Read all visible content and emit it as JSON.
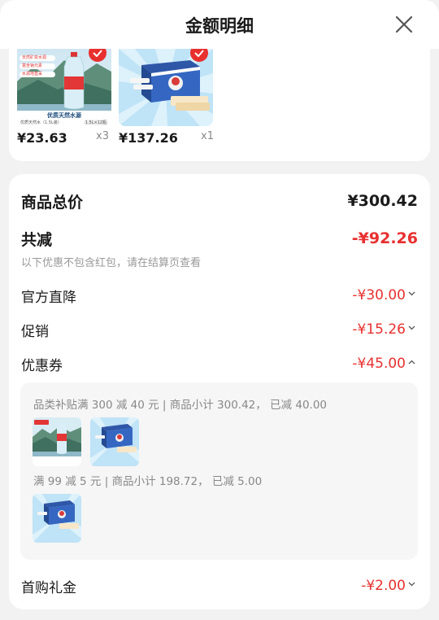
{
  "header": {
    "title": "金额明细"
  },
  "products": [
    {
      "label_lines": [
        "天然矿泉水源",
        "富含钠元素",
        "水源地直采"
      ],
      "banner": "优质天然水源",
      "sub_caption": "优质天然水（1.5L装）",
      "tag": "1.5L×12瓶",
      "price": "¥23.63",
      "qty": "x3"
    },
    {
      "price": "¥137.26",
      "qty": "x1"
    }
  ],
  "summary": {
    "total_label": "商品总价",
    "total_value": "¥300.42",
    "discount_label": "共减",
    "discount_value": "-¥92.26",
    "discount_note": "以下优惠不包含红包，请在结算页查看",
    "rows": [
      {
        "label": "官方直降",
        "value": "-¥30.00"
      },
      {
        "label": "促销",
        "value": "-¥15.26"
      },
      {
        "label": "优惠券",
        "value": "-¥45.00"
      }
    ],
    "coupons": [
      {
        "text": "品类补贴满 300 减 40 元 | 商品小计 300.42， 已减 40.00"
      },
      {
        "text": "满 99 减 5 元 | 商品小计 198.72， 已减 5.00"
      }
    ],
    "last_row": {
      "label": "首购礼金",
      "value": "-¥2.00"
    }
  },
  "colors": {
    "accent_red": "#e8302f",
    "background": "#f2f2f2"
  }
}
